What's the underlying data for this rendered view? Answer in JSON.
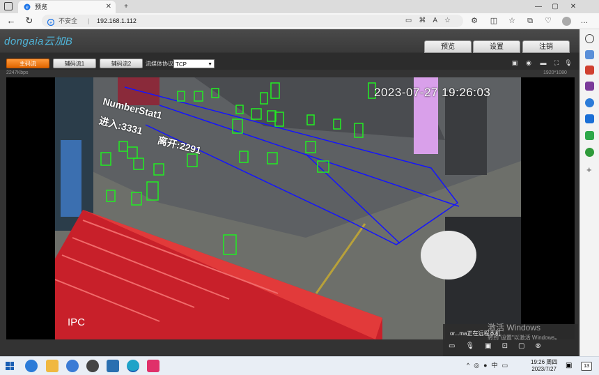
{
  "browser": {
    "tab_title": "预览",
    "security_label": "不安全",
    "url": "192.168.1.112",
    "new_tab": "+",
    "minimize": "—",
    "maximize": "▢",
    "close": "✕"
  },
  "app": {
    "logo": "dongaia云加B",
    "nav_tabs": [
      "预览",
      "设置",
      "注销"
    ],
    "stream_buttons": [
      "主码流",
      "辅码流1",
      "辅码流2"
    ],
    "protocol_label": "流媒体协议",
    "protocol_value": "TCP",
    "bitrate": "2247Kbps",
    "resolution": "1920*1080"
  },
  "video": {
    "timestamp": "2023-07-27  19:26:03",
    "camera_label": "IPC",
    "counter_title": "NumberStat1",
    "counter_enter": "进入:3331",
    "counter_exit": "离开:2291"
  },
  "remote_session": {
    "message": "or...ma正在远程本机",
    "activate_title": "激活 Windows",
    "activate_hint": "转到\"设置\"以激活 Windows。"
  },
  "taskbar": {
    "time": "19:26 周四",
    "date": "2023/7/27",
    "tray_lang": "中",
    "notification_count": "13"
  },
  "colors": {
    "accent_orange": "#e06600",
    "overlay_blue": "#1414ff",
    "detect_green": "#22ee22"
  }
}
